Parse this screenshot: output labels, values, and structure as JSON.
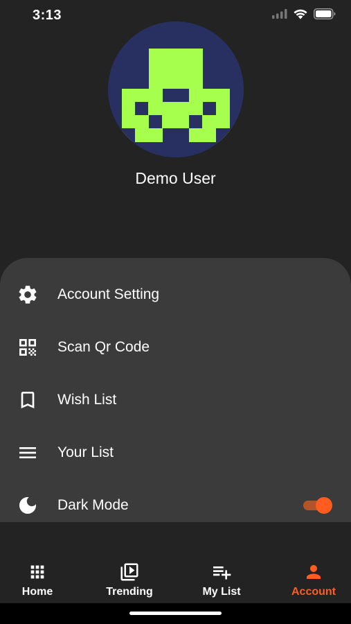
{
  "status_bar": {
    "time": "3:13",
    "icons": [
      "cellular-signal-icon",
      "wifi-icon",
      "battery-icon"
    ]
  },
  "profile": {
    "avatar_colors": {
      "background": "#273060",
      "pattern": "#a6ff4d"
    },
    "name": "Demo User"
  },
  "menu": {
    "items": [
      {
        "label": "Account Setting",
        "icon": "gear-icon"
      },
      {
        "label": "Scan Qr Code",
        "icon": "qr-code-icon"
      },
      {
        "label": "Wish List",
        "icon": "bookmark-icon"
      },
      {
        "label": "Your List",
        "icon": "list-icon"
      },
      {
        "label": "Dark Mode",
        "icon": "moon-icon",
        "toggle_on": true
      }
    ]
  },
  "bottom_nav": {
    "items": [
      {
        "label": "Home",
        "icon": "grid-icon",
        "active": false
      },
      {
        "label": "Trending",
        "icon": "play-library-icon",
        "active": false
      },
      {
        "label": "My List",
        "icon": "playlist-add-icon",
        "active": false
      },
      {
        "label": "Account",
        "icon": "person-icon",
        "active": true
      }
    ]
  },
  "colors": {
    "background": "#232323",
    "panel": "#3b3b3b",
    "accent": "#ff5d1f",
    "text": "#ffffff"
  }
}
